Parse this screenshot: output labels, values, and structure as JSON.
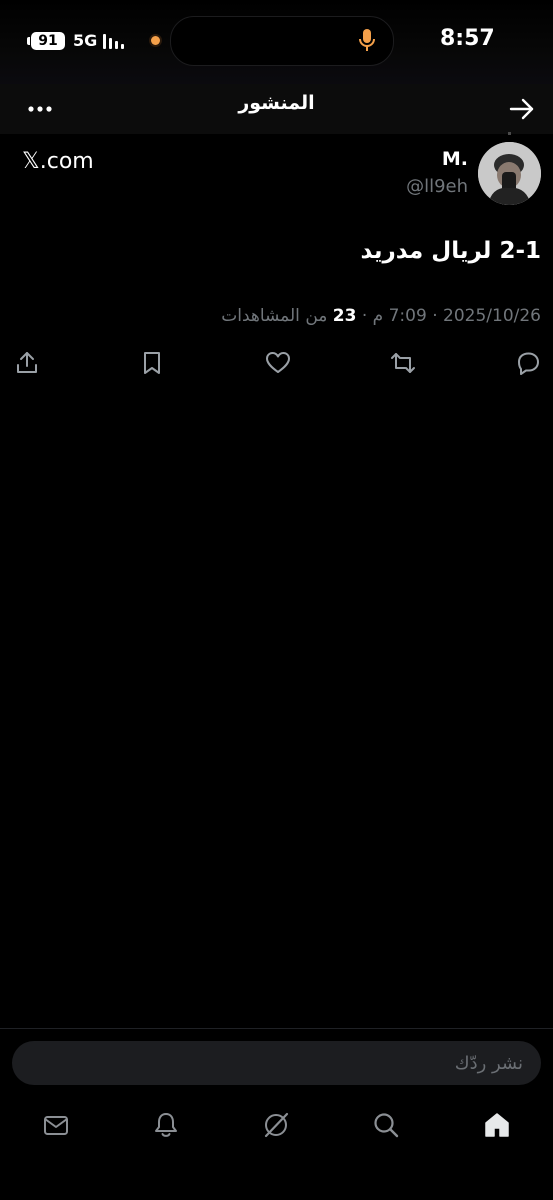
{
  "status_bar": {
    "battery": "91",
    "network": "5G",
    "time": "8:57",
    "icons": [
      "battery-icon",
      "signal-icon",
      "camera-indicator-icon",
      "microphone-icon"
    ],
    "camera_indicator_color": "#f4a04a"
  },
  "header": {
    "title": "المنشور",
    "icons": [
      "more-icon",
      "arrow-right-icon"
    ]
  },
  "post": {
    "display_name": "M.",
    "handle": "@ll9eh",
    "source": "𝕏.com",
    "text": "2-1 لريال مدريد",
    "date": "2025/10/26",
    "time": "7:09 م",
    "views_count": "23",
    "views_label": "من المشاهدات",
    "separator": "·",
    "actions": [
      "share-icon",
      "bookmark-icon",
      "like-icon",
      "repost-icon",
      "reply-icon"
    ]
  },
  "reply": {
    "placeholder": "نشر ردّك"
  },
  "tabbar": {
    "items": [
      "messages-icon",
      "notifications-icon",
      "grok-icon",
      "search-icon",
      "home-icon"
    ]
  },
  "colors": {
    "background": "#000000",
    "text_primary": "#ffffff",
    "text_secondary": "#71767b",
    "reply_field": "#1c1d20"
  }
}
